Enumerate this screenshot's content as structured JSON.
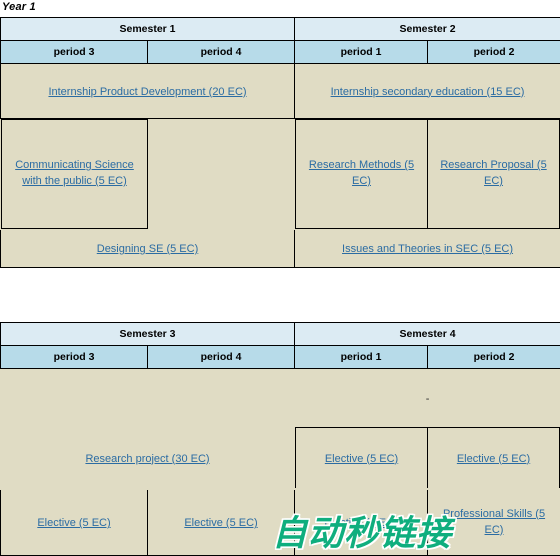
{
  "year_label": "Year 1",
  "table_year1": {
    "semesters": [
      {
        "label": "Semester 1",
        "periods": [
          "period 3",
          "period 4"
        ]
      },
      {
        "label": "Semester 2",
        "periods": [
          "period 1",
          "period 2"
        ]
      }
    ],
    "row_internship": {
      "left": "Internship Product Development  (20 EC)",
      "right": "Internship secondary education  (15 EC)"
    },
    "row_middle": {
      "sem1_period3": "Communicating Science with the public (5 EC)",
      "sem1_period4": "",
      "sem2_period1": "Research Methods (5 EC)",
      "sem2_period2": "Research Proposal (5 EC)"
    },
    "row_bottom": {
      "left": "Designing SE (5 EC)",
      "right": "Issues and Theories in SEC (5 EC)"
    }
  },
  "table_year2": {
    "semesters": [
      {
        "label": "Semester 3",
        "periods": [
          "period 3",
          "period 4"
        ]
      },
      {
        "label": "Semester 4",
        "periods": [
          "period 1",
          "period 2"
        ]
      }
    ],
    "row_top": {
      "left": "",
      "right": "-"
    },
    "row_middle": {
      "left": "Research project (30 EC)",
      "sem4_period1": "Elective (5 EC)",
      "sem4_period2": "Elective (5 EC)"
    },
    "row_bottom": {
      "sem3_period3": "Elective (5 EC)",
      "sem3_period4": "Elective (5 EC)",
      "sem4_period1": "Elective (5 EC)",
      "sem4_period2": "Professional Skills (5 EC)"
    }
  },
  "watermark": {
    "text": "自动秒链接",
    "color": "#0fae7e"
  },
  "colors": {
    "semester_header": "#dcebf3",
    "period_header": "#b7dbe9",
    "cell_background": "#e0dcc4",
    "link": "#2b6ca3",
    "border": "#000000"
  }
}
